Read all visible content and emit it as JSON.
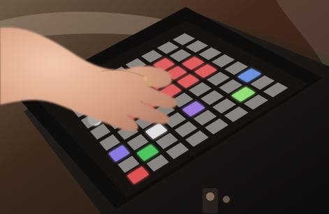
{
  "image": {
    "subject": "hand-pressing-illuminated-pad-grid-controller",
    "background_color": "#3d2a1b",
    "frame_color": "#0f0d0c",
    "pad_unlit_color": "#b7b4b1",
    "grid_rows": 8,
    "grid_cols": 8,
    "pad_colors": [
      [
        "#c9c6c2",
        "#c9c6c2",
        "#c9c6c2",
        "#c9c6c2",
        "#c9c6c2",
        "#c9c6c2",
        "#c9c6c2",
        "#c9c6c2"
      ],
      [
        "#c9c6c2",
        "#c9c6c2",
        "#c9c6c2",
        "#ff6b6b",
        "#ff6b6b",
        "#ff6b6b",
        "#c9c6c2",
        "#c9c6c2"
      ],
      [
        "#c9c6c2",
        "#c9c6c2",
        "#ff6b6b",
        "#ff6b6b",
        "#ff6b6b",
        "#ff6b6b",
        "#ff6b6b",
        "#c9c6c2"
      ],
      [
        "#c9c6c2",
        "#c9c6c2",
        "#ff6b6b",
        "#ff6b6b",
        "#ff6b6b",
        "#ff6b6b",
        "#ff6b6b",
        "#c9c6c2"
      ],
      [
        "#c9c6c2",
        "#c9c6c2",
        "#c9c6c2",
        "#c9c6c2",
        "#c9c6c2",
        "#c9c6c2",
        "#c9c6c2",
        "#c9c6c2"
      ],
      [
        "#9b8cff",
        "#c9c6c2",
        "#ffffff",
        "#c9c6c2",
        "#b28bff",
        "#c9c6c2",
        "#c9c6c2",
        "#7aa7ff"
      ],
      [
        "#c9c6c2",
        "#58e06b",
        "#c9c6c2",
        "#c9c6c2",
        "#c9c6c2",
        "#c9c6c2",
        "#a6ff87",
        "#c9c6c2"
      ],
      [
        "#ff5d5d",
        "#c9c6c2",
        "#c9c6c2",
        "#c9c6c2",
        "#c9c6c2",
        "#c9c6c2",
        "#c9c6c2",
        "#c9c6c2"
      ]
    ]
  }
}
